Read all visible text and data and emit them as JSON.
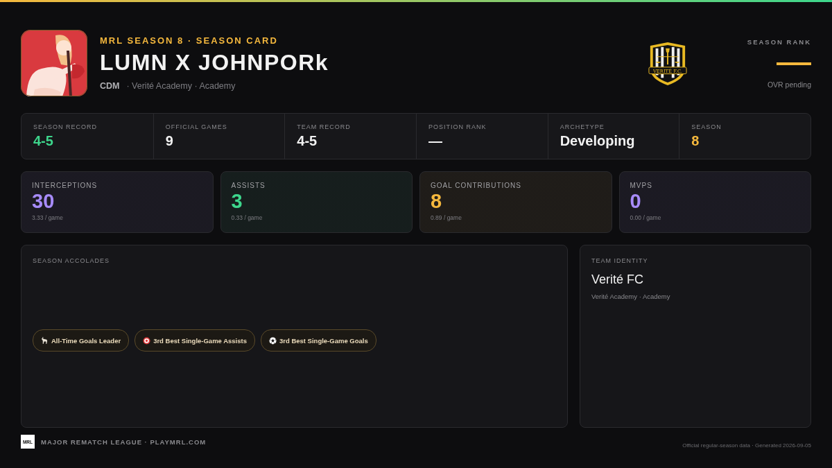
{
  "header": {
    "eyebrow": "MRL SEASON 8 · SEASON CARD",
    "player_name": "LUMN X JOHNPORk",
    "position": "CDM",
    "affiliation": "· Verité Academy · Academy",
    "crest_text": "VERITÉ F.C.",
    "rank_label": "SEASON RANK",
    "rank_note": "OVR pending"
  },
  "summary": [
    {
      "label": "SEASON RECORD",
      "value": "4-5",
      "color": "#3dd68c"
    },
    {
      "label": "OFFICIAL GAMES",
      "value": "9",
      "color": "#f2f2f2"
    },
    {
      "label": "TEAM RECORD",
      "value": "4-5",
      "color": "#f2f2f2"
    },
    {
      "label": "POSITION RANK",
      "value": "—",
      "color": "#f2f2f2"
    },
    {
      "label": "ARCHETYPE",
      "value": "Developing",
      "color": "#f2f2f2"
    },
    {
      "label": "SEASON",
      "value": "8",
      "color": "#f5b83d"
    }
  ],
  "metrics": [
    {
      "label": "INTERCEPTIONS",
      "value": "30",
      "per_game": "3.33 / game",
      "color": "#a78bfa"
    },
    {
      "label": "ASSISTS",
      "value": "3",
      "per_game": "0.33 / game",
      "color": "#3dd68c"
    },
    {
      "label": "GOAL CONTRIBUTIONS",
      "value": "8",
      "per_game": "0.89 / game",
      "color": "#f5b83d"
    },
    {
      "label": "MVPS",
      "value": "0",
      "per_game": "0.00 / game",
      "color": "#a78bfa"
    }
  ],
  "accolades": {
    "title": "SEASON ACCOLADES",
    "items": [
      {
        "kind": "goat",
        "label": "All-Time Goals Leader"
      },
      {
        "kind": "target",
        "label": "3rd Best Single-Game Assists"
      },
      {
        "kind": "ball",
        "label": "3rd Best Single-Game Goals"
      }
    ]
  },
  "team_identity": {
    "title": "TEAM IDENTITY",
    "team": "Verité FC",
    "subtitle": "Verité Academy · Academy"
  },
  "footer": {
    "logo": "MRL",
    "league": "MAJOR REMATCH LEAGUE · PLAYMRL.COM",
    "note": "Official regular-season data · Generated 2026-09-05"
  }
}
